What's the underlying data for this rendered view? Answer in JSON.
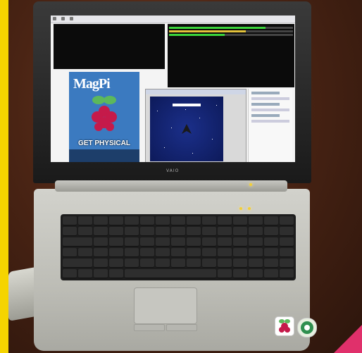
{
  "scene": {
    "description_tags": [
      "laptop-photo",
      "raspberry-pi-desktop-on-screen"
    ]
  },
  "screen": {
    "terminal_left_lines": [
      "",
      "",
      "",
      "",
      "",
      "",
      ""
    ],
    "terminal_right_lines": [
      "",
      "",
      "",
      ""
    ],
    "progress_levels": [
      0.78,
      0.62,
      0.45
    ],
    "magazine_title": "MagPi",
    "magazine_cover_text": "GET PHYSICAL",
    "brand_label": "VAIO"
  },
  "colors": {
    "frame_yellow": "#f5d400",
    "magazine_blue": "#3b7ac0",
    "terminal_green": "#3bd43b",
    "accent_pink": "#e0306b"
  }
}
